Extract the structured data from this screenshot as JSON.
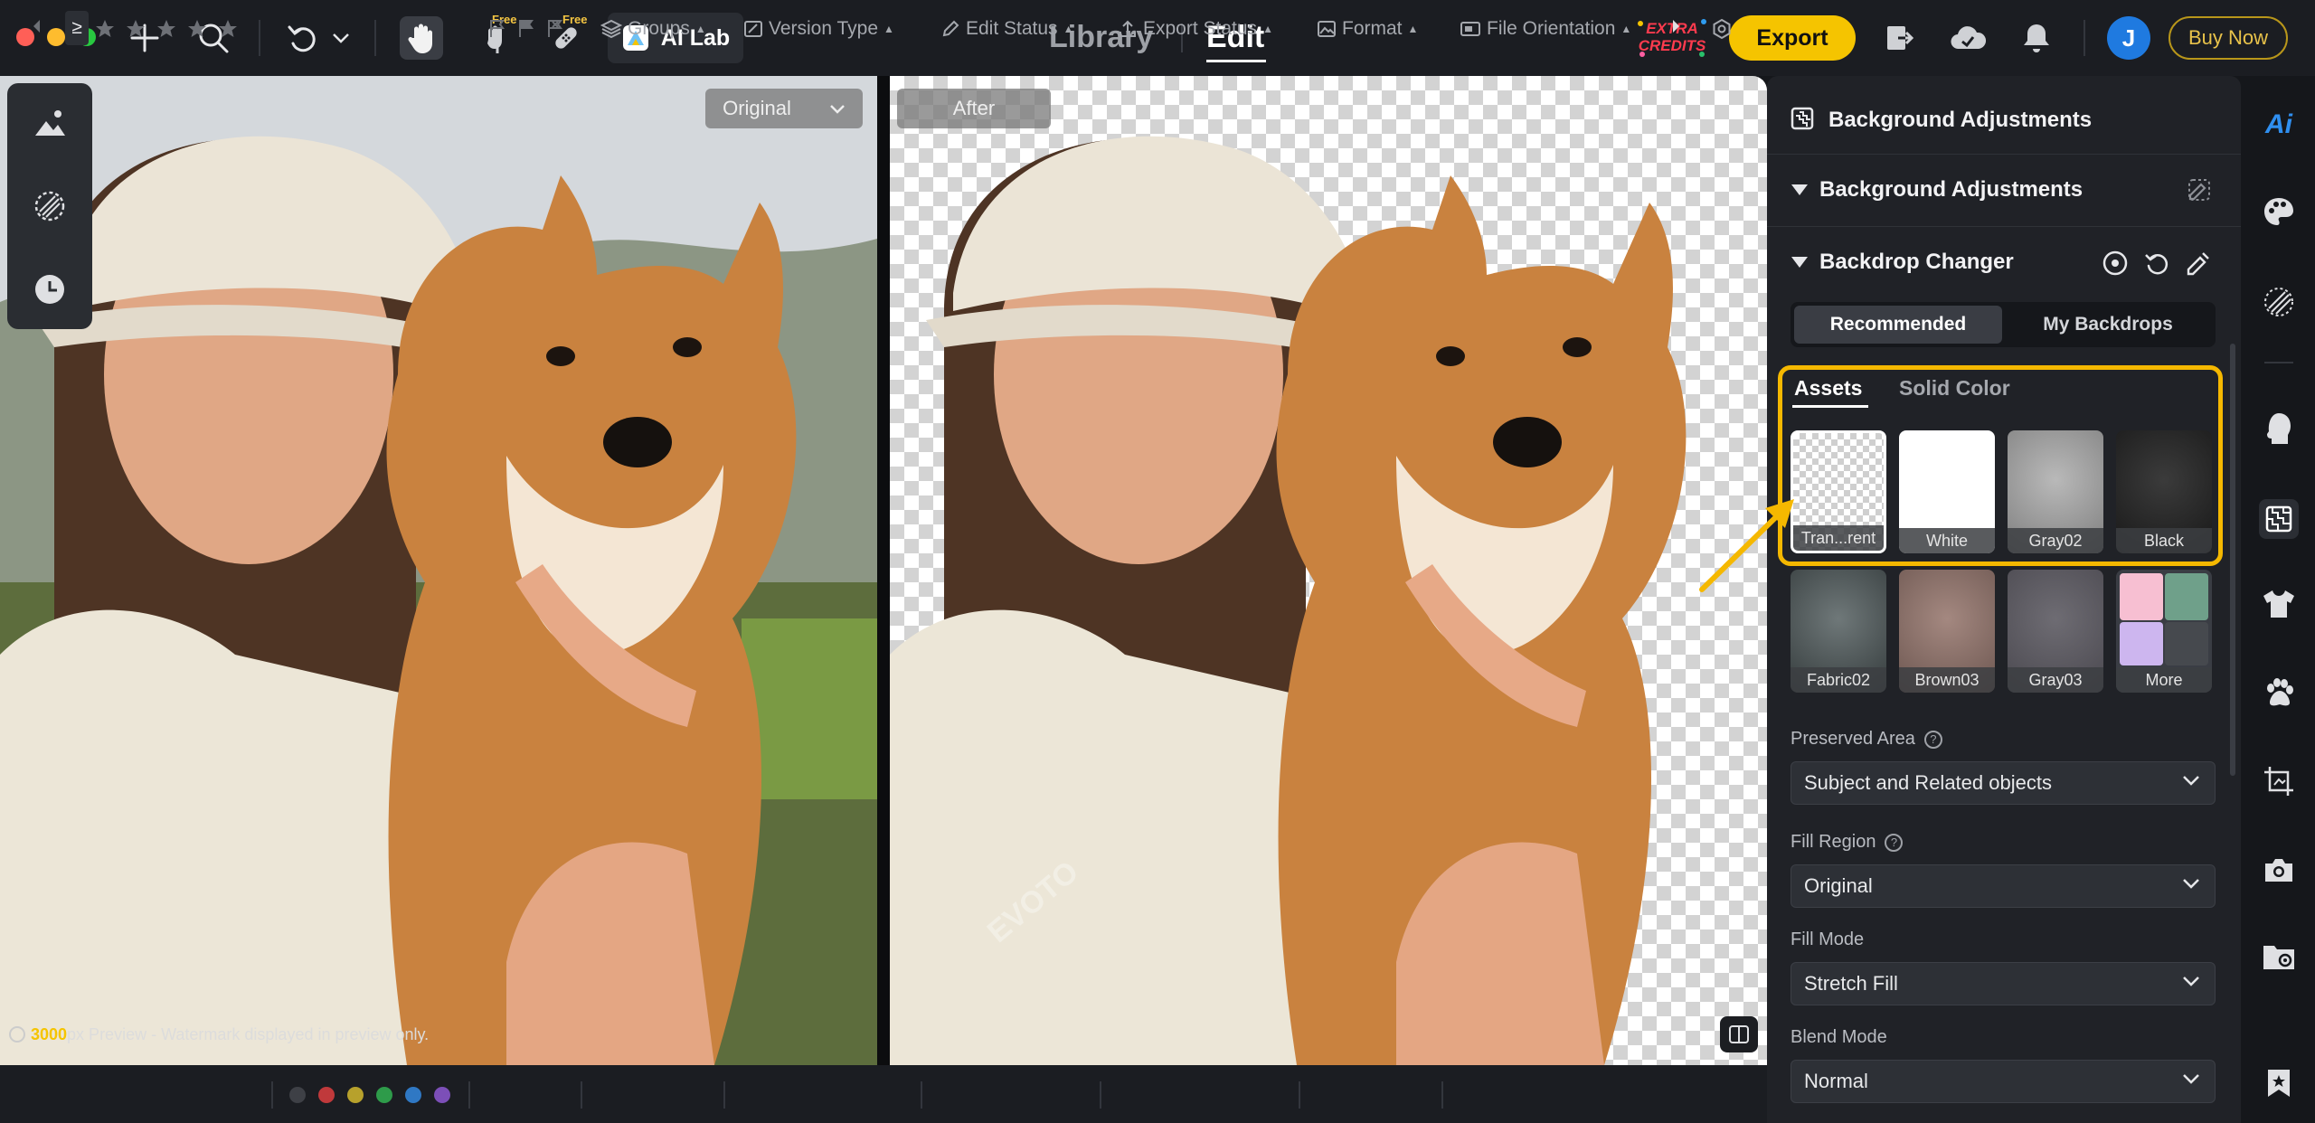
{
  "topbar": {
    "free_badge_1": "Free",
    "free_badge_2": "Free",
    "ai_lab_label": "AI Lab",
    "nav_library": "Library",
    "nav_edit": "Edit",
    "extra_credits_line1": "EXTRA",
    "extra_credits_line2": "CREDITS",
    "export_label": "Export",
    "avatar_initial": "J",
    "buy_now_label": "Buy Now"
  },
  "canvas": {
    "original_label": "Original",
    "after_label": "After",
    "preview_px": "3000",
    "preview_note_rest": "px Preview - Watermark displayed in preview only.",
    "watermark_text": "EVOTO"
  },
  "bottombar": {
    "rating_filter_symbol": "≥",
    "groups_label": "Groups",
    "version_type_label": "Version Type",
    "edit_status_label": "Edit Status",
    "export_status_label": "Export Status",
    "format_label": "Format",
    "file_orientation_label": "File Orientation",
    "color_labels": [
      "#3e4046",
      "#c0393b",
      "#b7a12c",
      "#2e9b4a",
      "#2f78c4",
      "#7c4fb8"
    ]
  },
  "panel": {
    "header_title": "Background Adjustments",
    "section1_title": "Background Adjustments",
    "section2_title": "Backdrop Changer",
    "seg_recommended": "Recommended",
    "seg_my_backdrops": "My Backdrops",
    "tab_assets": "Assets",
    "tab_solid_color": "Solid Color",
    "backdrops": [
      {
        "label": "Tran...rent"
      },
      {
        "label": "White"
      },
      {
        "label": "Gray02"
      },
      {
        "label": "Black"
      },
      {
        "label": "Fabric02"
      },
      {
        "label": "Brown03"
      },
      {
        "label": "Gray03"
      },
      {
        "label": "More"
      }
    ],
    "preserved_area_label": "Preserved Area",
    "preserved_area_value": "Subject and Related objects",
    "fill_region_label": "Fill Region",
    "fill_region_value": "Original",
    "fill_mode_label": "Fill Mode",
    "fill_mode_value": "Stretch Fill",
    "blend_mode_label": "Blend Mode",
    "blend_mode_value": "Normal",
    "help_symbol": "?",
    "accent_color": "#f5b800"
  },
  "rail": {
    "ai_label": "Ai"
  }
}
